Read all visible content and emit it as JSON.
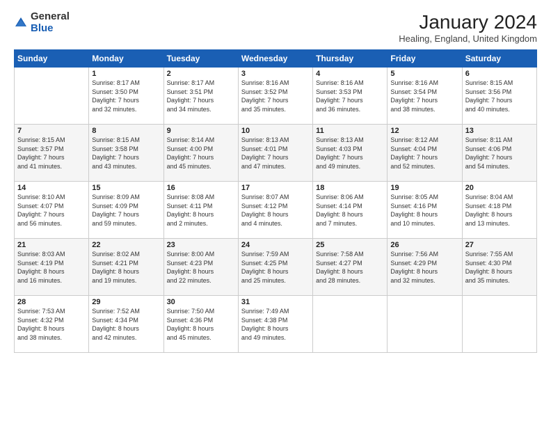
{
  "logo": {
    "text_general": "General",
    "text_blue": "Blue"
  },
  "title": "January 2024",
  "subtitle": "Healing, England, United Kingdom",
  "days_of_week": [
    "Sunday",
    "Monday",
    "Tuesday",
    "Wednesday",
    "Thursday",
    "Friday",
    "Saturday"
  ],
  "weeks": [
    [
      {
        "day": "",
        "info": ""
      },
      {
        "day": "1",
        "info": "Sunrise: 8:17 AM\nSunset: 3:50 PM\nDaylight: 7 hours\nand 32 minutes."
      },
      {
        "day": "2",
        "info": "Sunrise: 8:17 AM\nSunset: 3:51 PM\nDaylight: 7 hours\nand 34 minutes."
      },
      {
        "day": "3",
        "info": "Sunrise: 8:16 AM\nSunset: 3:52 PM\nDaylight: 7 hours\nand 35 minutes."
      },
      {
        "day": "4",
        "info": "Sunrise: 8:16 AM\nSunset: 3:53 PM\nDaylight: 7 hours\nand 36 minutes."
      },
      {
        "day": "5",
        "info": "Sunrise: 8:16 AM\nSunset: 3:54 PM\nDaylight: 7 hours\nand 38 minutes."
      },
      {
        "day": "6",
        "info": "Sunrise: 8:15 AM\nSunset: 3:56 PM\nDaylight: 7 hours\nand 40 minutes."
      }
    ],
    [
      {
        "day": "7",
        "info": "Sunrise: 8:15 AM\nSunset: 3:57 PM\nDaylight: 7 hours\nand 41 minutes."
      },
      {
        "day": "8",
        "info": "Sunrise: 8:15 AM\nSunset: 3:58 PM\nDaylight: 7 hours\nand 43 minutes."
      },
      {
        "day": "9",
        "info": "Sunrise: 8:14 AM\nSunset: 4:00 PM\nDaylight: 7 hours\nand 45 minutes."
      },
      {
        "day": "10",
        "info": "Sunrise: 8:13 AM\nSunset: 4:01 PM\nDaylight: 7 hours\nand 47 minutes."
      },
      {
        "day": "11",
        "info": "Sunrise: 8:13 AM\nSunset: 4:03 PM\nDaylight: 7 hours\nand 49 minutes."
      },
      {
        "day": "12",
        "info": "Sunrise: 8:12 AM\nSunset: 4:04 PM\nDaylight: 7 hours\nand 52 minutes."
      },
      {
        "day": "13",
        "info": "Sunrise: 8:11 AM\nSunset: 4:06 PM\nDaylight: 7 hours\nand 54 minutes."
      }
    ],
    [
      {
        "day": "14",
        "info": "Sunrise: 8:10 AM\nSunset: 4:07 PM\nDaylight: 7 hours\nand 56 minutes."
      },
      {
        "day": "15",
        "info": "Sunrise: 8:09 AM\nSunset: 4:09 PM\nDaylight: 7 hours\nand 59 minutes."
      },
      {
        "day": "16",
        "info": "Sunrise: 8:08 AM\nSunset: 4:11 PM\nDaylight: 8 hours\nand 2 minutes."
      },
      {
        "day": "17",
        "info": "Sunrise: 8:07 AM\nSunset: 4:12 PM\nDaylight: 8 hours\nand 4 minutes."
      },
      {
        "day": "18",
        "info": "Sunrise: 8:06 AM\nSunset: 4:14 PM\nDaylight: 8 hours\nand 7 minutes."
      },
      {
        "day": "19",
        "info": "Sunrise: 8:05 AM\nSunset: 4:16 PM\nDaylight: 8 hours\nand 10 minutes."
      },
      {
        "day": "20",
        "info": "Sunrise: 8:04 AM\nSunset: 4:18 PM\nDaylight: 8 hours\nand 13 minutes."
      }
    ],
    [
      {
        "day": "21",
        "info": "Sunrise: 8:03 AM\nSunset: 4:19 PM\nDaylight: 8 hours\nand 16 minutes."
      },
      {
        "day": "22",
        "info": "Sunrise: 8:02 AM\nSunset: 4:21 PM\nDaylight: 8 hours\nand 19 minutes."
      },
      {
        "day": "23",
        "info": "Sunrise: 8:00 AM\nSunset: 4:23 PM\nDaylight: 8 hours\nand 22 minutes."
      },
      {
        "day": "24",
        "info": "Sunrise: 7:59 AM\nSunset: 4:25 PM\nDaylight: 8 hours\nand 25 minutes."
      },
      {
        "day": "25",
        "info": "Sunrise: 7:58 AM\nSunset: 4:27 PM\nDaylight: 8 hours\nand 28 minutes."
      },
      {
        "day": "26",
        "info": "Sunrise: 7:56 AM\nSunset: 4:29 PM\nDaylight: 8 hours\nand 32 minutes."
      },
      {
        "day": "27",
        "info": "Sunrise: 7:55 AM\nSunset: 4:30 PM\nDaylight: 8 hours\nand 35 minutes."
      }
    ],
    [
      {
        "day": "28",
        "info": "Sunrise: 7:53 AM\nSunset: 4:32 PM\nDaylight: 8 hours\nand 38 minutes."
      },
      {
        "day": "29",
        "info": "Sunrise: 7:52 AM\nSunset: 4:34 PM\nDaylight: 8 hours\nand 42 minutes."
      },
      {
        "day": "30",
        "info": "Sunrise: 7:50 AM\nSunset: 4:36 PM\nDaylight: 8 hours\nand 45 minutes."
      },
      {
        "day": "31",
        "info": "Sunrise: 7:49 AM\nSunset: 4:38 PM\nDaylight: 8 hours\nand 49 minutes."
      },
      {
        "day": "",
        "info": ""
      },
      {
        "day": "",
        "info": ""
      },
      {
        "day": "",
        "info": ""
      }
    ]
  ]
}
